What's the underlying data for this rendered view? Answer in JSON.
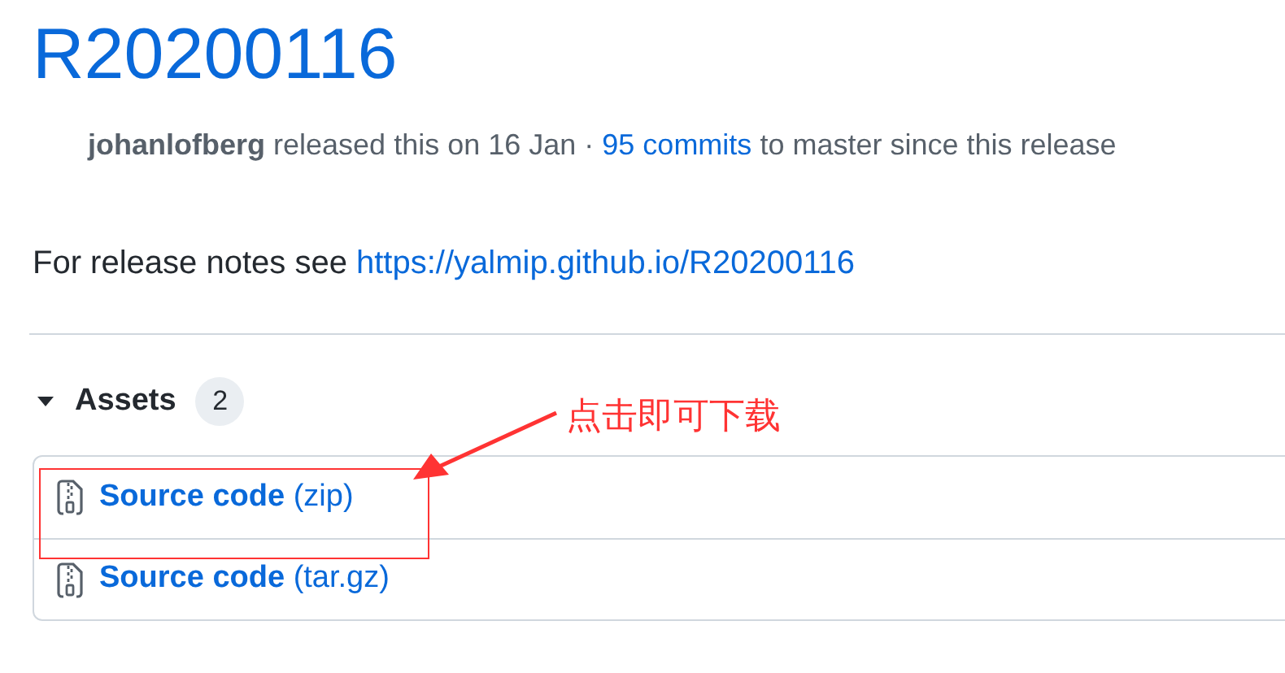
{
  "release": {
    "title": "R20200116",
    "meta": {
      "author": "johanlofberg",
      "text_1": "released this on 16 Jan ·",
      "commits_link": "95 commits",
      "text_2": "to master since this release"
    },
    "notes": {
      "text": "For release notes see",
      "link": "https://yalmip.github.io/R20200116"
    }
  },
  "assets": {
    "heading": "Assets",
    "count": "2",
    "expanded": true,
    "items": [
      {
        "name": "Source code",
        "format": "(zip)"
      },
      {
        "name": "Source code",
        "format": "(tar.gz)"
      }
    ]
  },
  "annotation": {
    "text": "点击即可下载"
  }
}
